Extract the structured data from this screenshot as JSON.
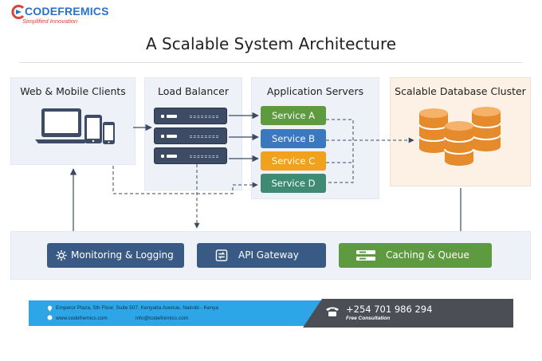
{
  "brand": {
    "name": "CODEFREMICS",
    "tagline": "Simplified Innovation",
    "colors": {
      "blue": "#2a72c9",
      "red": "#e0403a"
    }
  },
  "title": "A Scalable System Architecture",
  "panels": {
    "clients": "Web & Mobile Clients",
    "load_balancer": "Load Balancer",
    "app_servers": "Application Servers",
    "database": "Scalable Database Cluster"
  },
  "services": [
    {
      "label": "Service A",
      "color": "#5e9a3f"
    },
    {
      "label": "Service B",
      "color": "#3a79bf"
    },
    {
      "label": "Service C",
      "color": "#f0a21c"
    },
    {
      "label": "Service D",
      "color": "#3f8a73"
    }
  ],
  "tools": [
    {
      "label": "Monitoring & Logging",
      "icon": "gear-icon",
      "color": "#3a5a86"
    },
    {
      "label": "API Gateway",
      "icon": "gateway-icon",
      "color": "#3a5a86"
    },
    {
      "label": "Caching & Queue",
      "icon": "queue-icon",
      "color": "#5e9a3f"
    }
  ],
  "footer": {
    "address": "Emperor Plaza, 5th Floor, Suite 507, Kenyatta Avenue, Nairobi - Kenya",
    "website": "www.codefremics.com",
    "email": "info@codefremics.com",
    "phone": "+254 701 986 294",
    "consultation": "Free Consultation"
  }
}
